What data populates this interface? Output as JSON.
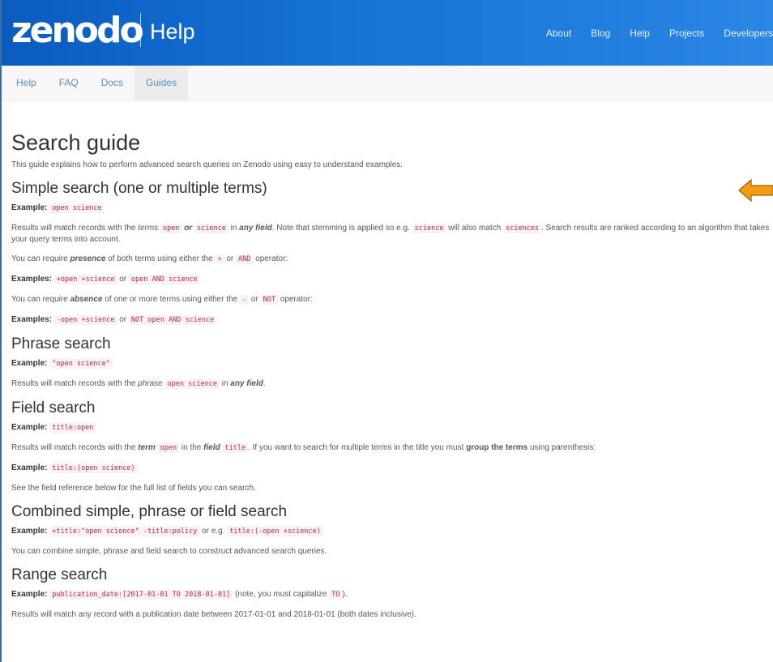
{
  "header": {
    "logo": "zenodo",
    "section": "Help",
    "nav": [
      "About",
      "Blog",
      "Help",
      "Projects",
      "Developers"
    ]
  },
  "subnav": {
    "items": [
      "Help",
      "FAQ",
      "Docs",
      "Guides"
    ],
    "active": "Guides"
  },
  "page": {
    "title": "Search guide",
    "intro": "This guide explains how to perform advanced search queries on Zenodo using easy to understand examples."
  },
  "simple": {
    "heading": "Simple search (one or multiple terms)",
    "ex_label": "Example:",
    "ex_code": "open science",
    "p1_a": "Results will match records with the ",
    "p1_terms": "terms",
    "p1_b": " ",
    "p1_code1": "open",
    "p1_or": "or",
    "p1_code2": "science",
    "p1_c": " in ",
    "p1_anyfield": "any field",
    "p1_d": ". Note that stemming is applied so e.g. ",
    "p1_code3": "science",
    "p1_e": " will also match ",
    "p1_code4": "sciences",
    "p1_f": ". Search results are ranked according to an algorithm that takes your query terms into account.",
    "p2_a": "You can require ",
    "p2_presence": "presence",
    "p2_b": " of both terms using either the ",
    "p2_code1": "+",
    "p2_c": " or ",
    "p2_code2": "AND",
    "p2_d": " operator:",
    "ex2_label": "Examples:",
    "ex2_code1": "+open +science",
    "ex2_or": " or ",
    "ex2_code2": "open AND science",
    "p3_a": "You can require ",
    "p3_absence": "absence",
    "p3_b": " of one or more terms using either the ",
    "p3_code1": "-",
    "p3_c": " or ",
    "p3_code2": "NOT",
    "p3_d": " operator:",
    "ex3_label": "Examples:",
    "ex3_code1": "-open +science",
    "ex3_or": " or ",
    "ex3_code2": "NOT open AND science"
  },
  "phrase": {
    "heading": "Phrase search",
    "ex_label": "Example:",
    "ex_code": "\"open science\"",
    "p_a": "Results will match records with the ",
    "p_phrase": "phrase",
    "p_b": " ",
    "p_code": "open science",
    "p_c": " in ",
    "p_anyfield": "any field",
    "p_d": "."
  },
  "field": {
    "heading": "Field search",
    "ex_label": "Example:",
    "ex_code": "title:open",
    "p1_a": "Results will match records with the ",
    "p1_term": "term",
    "p1_b": " ",
    "p1_code1": "open",
    "p1_c": " in the ",
    "p1_field": "field",
    "p1_d": " ",
    "p1_code2": "title",
    "p1_e": ". If you want to search for multiple terms in the title you must ",
    "p1_group": "group the terms",
    "p1_f": " using parenthesis:",
    "ex2_label": "Example:",
    "ex2_code": "title:(open science)",
    "p2": "See the field reference below for the full list of fields you can search."
  },
  "combined": {
    "heading": "Combined simple, phrase or field search",
    "ex_label": "Example:",
    "ex_code1": "+title:\"open science\" -title:policy",
    "ex_or": " or e.g. ",
    "ex_code2": "title:(-open +science)",
    "p": "You can combine simple, phrase and field search to construct advanced search queries."
  },
  "range": {
    "heading": "Range search",
    "ex_label": "Example:",
    "ex_code1": "publication_date:[2017-01-01 TO 2018-01-01]",
    "ex_note_a": " (note, you must capitalize ",
    "ex_code2": "TO",
    "ex_note_b": ").",
    "p": "Results will match any record with a publication date between 2017-01-01 and 2018-01-01 (both dates inclusive)."
  },
  "colors": {
    "header": "#1673d6",
    "code_text": "#c7254e",
    "code_bg": "#f9f2f4",
    "arrow": "#f39c12",
    "link": "#5a8ec8"
  },
  "icons": {
    "arrow": "left-arrow-icon"
  }
}
